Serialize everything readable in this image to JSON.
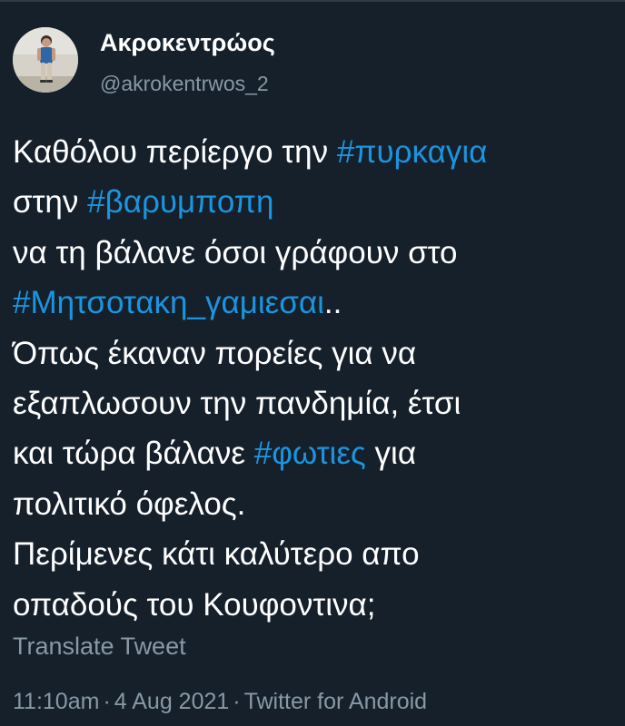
{
  "user": {
    "display_name": "Ακροκεντρώος",
    "handle": "@akrokentrwos_2"
  },
  "tweet": {
    "lines": [
      [
        {
          "text": "Καθόλου περίεργο την "
        },
        {
          "text": "#πυρκαγια",
          "hashtag": true
        }
      ],
      [
        {
          "text": "στην "
        },
        {
          "text": "#βαρυμποπη",
          "hashtag": true
        }
      ],
      [
        {
          "text": "να τη βάλανε όσοι γράφουν στο"
        }
      ],
      [
        {
          "text": "#Μητσοτακη_γαμιεσαι",
          "hashtag": true
        },
        {
          "text": ".."
        }
      ],
      [
        {
          "text": "Όπως έκαναν πορείες για να"
        }
      ],
      [
        {
          "text": "εξαπλωσουν την πανδημία, έτσι"
        }
      ],
      [
        {
          "text": "και τώρα βάλανε "
        },
        {
          "text": "#φωτιες",
          "hashtag": true
        },
        {
          "text": " για"
        }
      ],
      [
        {
          "text": "πολιτικό όφελος."
        }
      ],
      [
        {
          "text": "Περίμενες κάτι καλύτερο απο"
        }
      ],
      [
        {
          "text": "οπαδούς του Κουφοντινα;"
        }
      ]
    ]
  },
  "translate_label": "Translate Tweet",
  "meta": {
    "time": "11:10am",
    "date": "4 Aug 2021",
    "separator": "·",
    "client": "Twitter for Android"
  },
  "colors": {
    "background": "#15202b",
    "text": "#ffffff",
    "secondary": "#8899a6",
    "hashtag": "#1b95e0"
  },
  "icons": {
    "avatar": "user-avatar-photo"
  }
}
